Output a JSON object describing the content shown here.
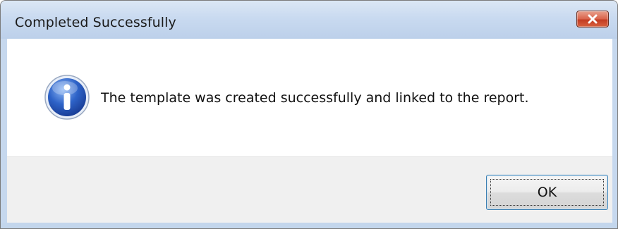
{
  "dialog": {
    "title": "Completed Successfully",
    "message": "The template was created successfully and linked to the report.",
    "icon": "information-icon",
    "ok_label": "OK",
    "close_icon": "close-icon"
  },
  "colors": {
    "titlebar": "#c9daf0",
    "close_button": "#d9634a",
    "footer": "#f0f0f0",
    "content": "#ffffff",
    "info_icon_blue": "#2e63c8"
  }
}
